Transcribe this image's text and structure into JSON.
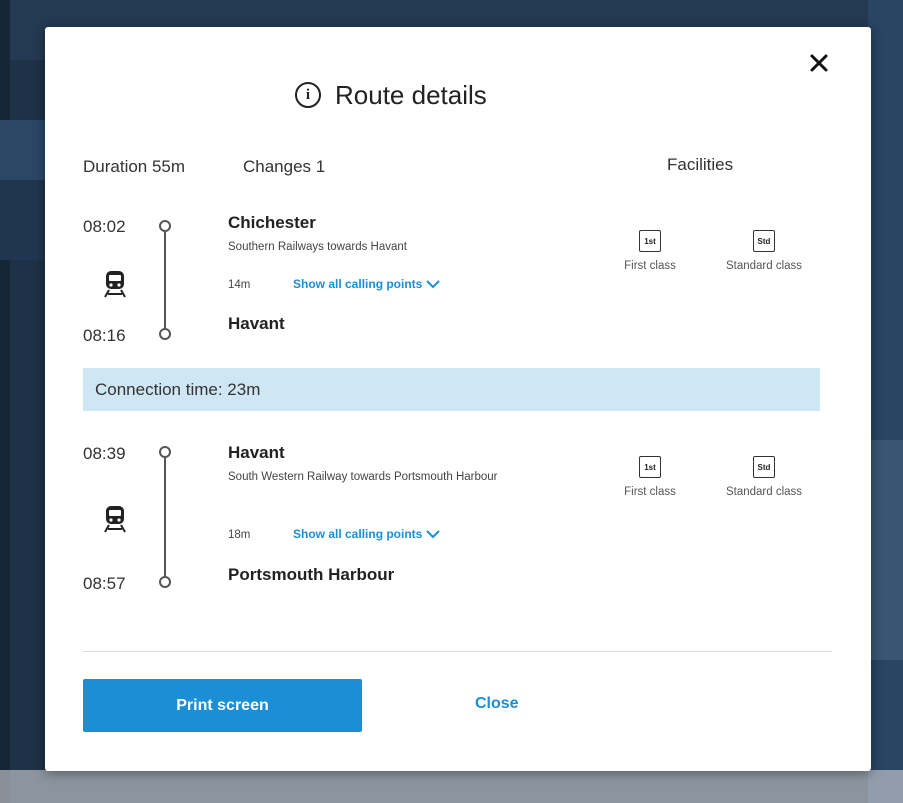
{
  "modal": {
    "title": "Route details",
    "summary": {
      "duration": "Duration 55m",
      "changes": "Changes 1",
      "facilities_heading": "Facilities"
    },
    "legs": [
      {
        "depart_time": "08:02",
        "arrive_time": "08:16",
        "from": "Chichester",
        "operator": "Southern Railways towards Havant",
        "duration": "14m",
        "calling_points": "Show all calling points",
        "to": "Havant",
        "facilities": [
          {
            "badge": "1st",
            "label": "First class"
          },
          {
            "badge": "Std",
            "label": "Standard class"
          }
        ]
      },
      {
        "depart_time": "08:39",
        "arrive_time": "08:57",
        "from": "Havant",
        "operator": "South Western Railway towards Portsmouth Harbour",
        "duration": "18m",
        "calling_points": "Show all calling points",
        "to": "Portsmouth Harbour",
        "facilities": [
          {
            "badge": "1st",
            "label": "First class"
          },
          {
            "badge": "Std",
            "label": "Standard class"
          }
        ]
      }
    ],
    "connection": "Connection time: 23m",
    "buttons": {
      "print": "Print screen",
      "close": "Close"
    }
  },
  "colors": {
    "accent": "#1a8fd6",
    "connection_bg": "#cfe6f4"
  },
  "icons": [
    "close-icon",
    "info-icon",
    "train-icon",
    "chevron-down-icon"
  ]
}
